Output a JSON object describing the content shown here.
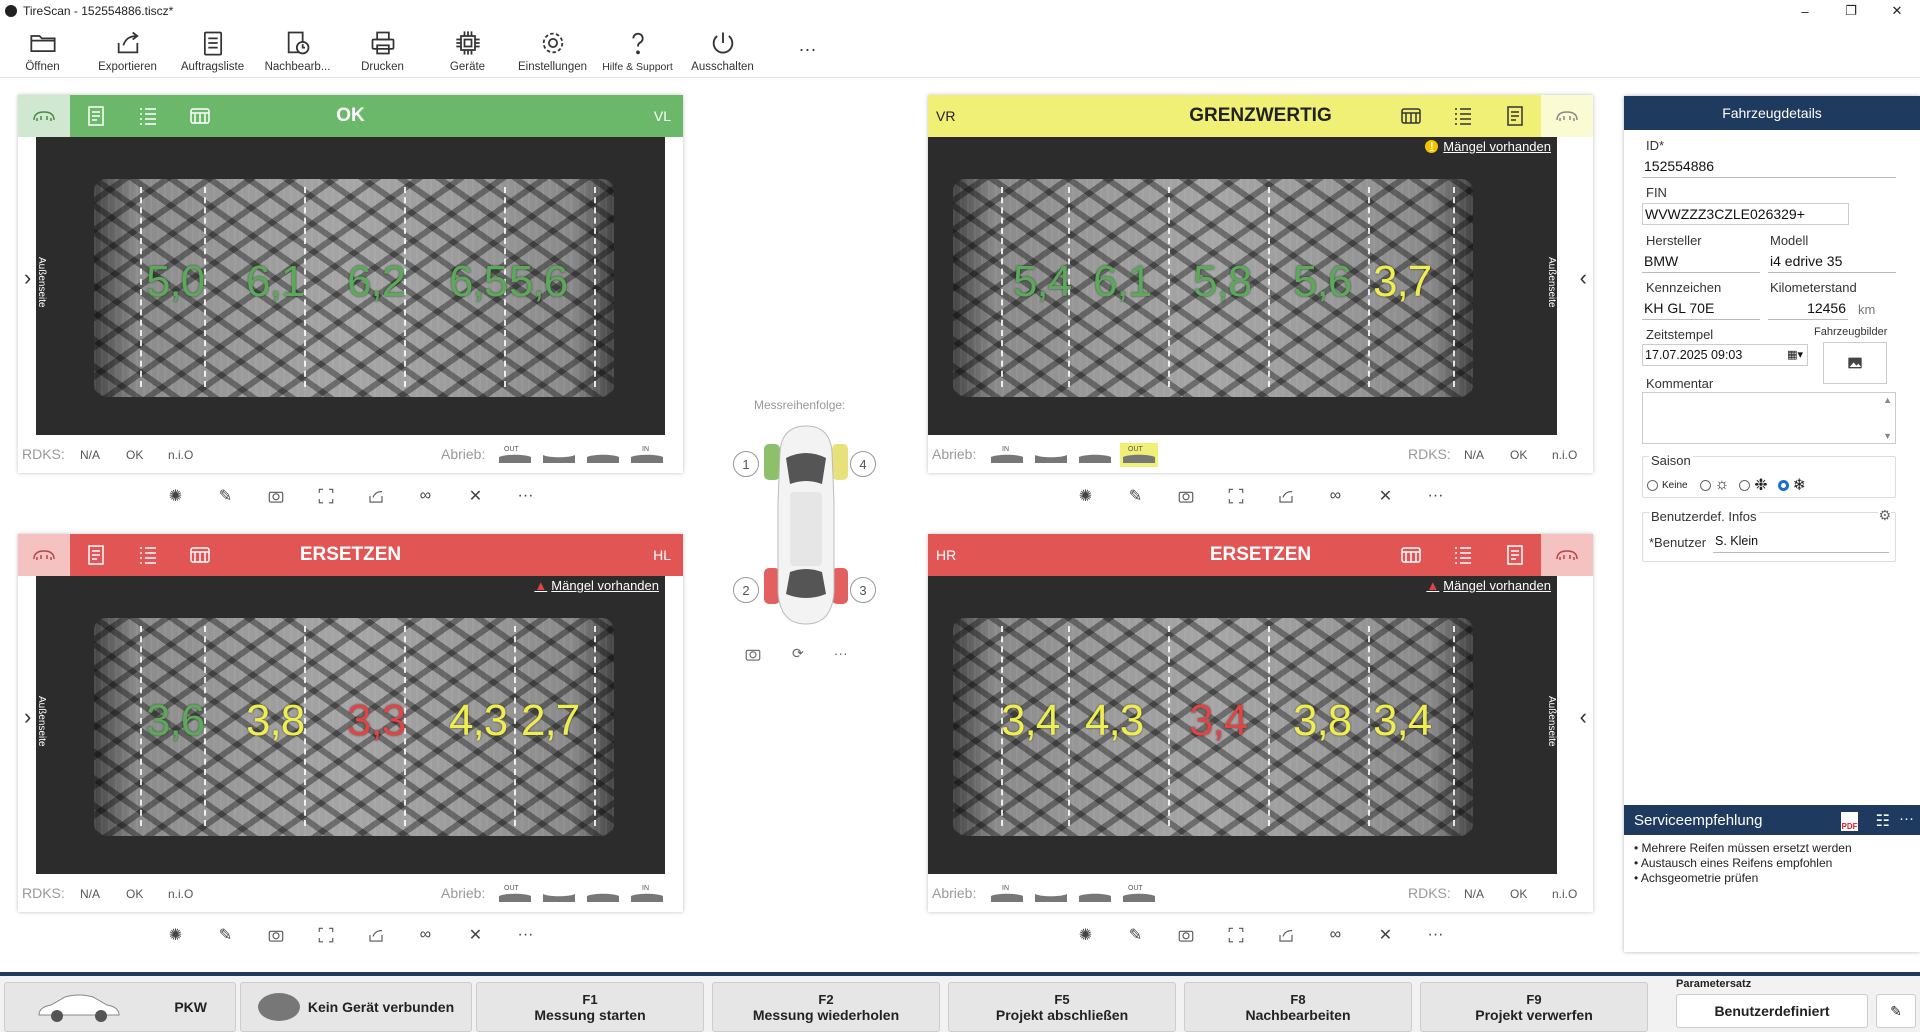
{
  "window": {
    "title": "TireScan - 152554886.tiscz*",
    "controls": [
      "–",
      "❐",
      "✕"
    ]
  },
  "toolbar": [
    {
      "label": "Öffnen",
      "icon": "folder-icon"
    },
    {
      "label": "Exportieren",
      "icon": "export-icon"
    },
    {
      "label": "Auftragsliste",
      "icon": "clipboard-icon"
    },
    {
      "label": "Nachbearb...",
      "icon": "edit-clock-icon"
    },
    {
      "label": "Drucken",
      "icon": "printer-icon"
    },
    {
      "label": "Geräte",
      "icon": "chip-icon"
    },
    {
      "label": "Einstellungen",
      "icon": "gear-icon"
    },
    {
      "label": "Hilfe & Support",
      "icon": "question-icon"
    },
    {
      "label": "Ausschalten",
      "icon": "power-icon"
    },
    {
      "label": "···",
      "icon": "more-icon"
    }
  ],
  "tires": {
    "vl": {
      "position": "VL",
      "status": "OK",
      "side": "Außenseite",
      "depths": [
        "5,0",
        "6,1",
        "6,2",
        "6,5",
        "5,6"
      ],
      "colors": [
        "green",
        "green",
        "green",
        "green",
        "green"
      ],
      "defect": ""
    },
    "vr": {
      "position": "VR",
      "status": "GRENZWERTIG",
      "side": "Außenseite",
      "depths": [
        "5,4",
        "6,1",
        "5,8",
        "5,6",
        "3,7"
      ],
      "colors": [
        "green",
        "green",
        "green",
        "green",
        "yellow"
      ],
      "defect": "Mängel vorhanden"
    },
    "hl": {
      "position": "HL",
      "status": "ERSETZEN",
      "side": "Außenseite",
      "depths": [
        "3,6",
        "3,8",
        "3,3",
        "4,3",
        "2,7"
      ],
      "colors": [
        "green",
        "yellow",
        "red",
        "yellow",
        "yellow"
      ],
      "defect": "Mängel vorhanden"
    },
    "hr": {
      "position": "HR",
      "status": "ERSETZEN",
      "side": "Außenseite",
      "depths": [
        "3,4",
        "4,3",
        "3,4",
        "3,8",
        "3,4"
      ],
      "colors": [
        "yellow",
        "yellow",
        "red",
        "yellow",
        "yellow"
      ],
      "defect": "Mängel vorhanden"
    }
  },
  "footer": {
    "rdks": "RDKS:",
    "na": "N/A",
    "ok": "OK",
    "nio": "n.i.O",
    "abrieb": "Abrieb:",
    "out": "OUT",
    "in": "IN"
  },
  "center": {
    "sequence_label": "Messreihenfolge:",
    "numbers": [
      "1",
      "4",
      "2",
      "3"
    ]
  },
  "details": {
    "title": "Fahrzeugdetails",
    "id_label": "ID*",
    "id": "152554886",
    "fin_label": "FIN",
    "fin": "WVWZZZ3CZLE026329+",
    "hersteller_label": "Hersteller",
    "hersteller": "BMW",
    "modell_label": "Modell",
    "modell": "i4 edrive 35",
    "kennzeichen_label": "Kennzeichen",
    "kennzeichen": "KH GL 70E",
    "km_label": "Kilometerstand",
    "km": "12456",
    "km_unit": "km",
    "zeit_label": "Zeitstempel",
    "zeit": "17.07.2025 09:03",
    "bilder_label": "Fahrzeugbilder",
    "kommentar_label": "Kommentar",
    "saison_label": "Saison",
    "saison_keine": "Keine",
    "saison_selected": "winter",
    "benutzer_infos_label": "Benutzerdef. Infos",
    "benutzer_label": "*Benutzer",
    "benutzer": "S. Klein"
  },
  "service": {
    "title": "Serviceempfehlung",
    "items": [
      "• Mehrere Reifen müssen ersetzt werden",
      "• Austausch eines Reifens empfohlen",
      "• Achsgeometrie prüfen"
    ]
  },
  "bottom": {
    "pkw": "PKW",
    "device": "Kein Gerät verbunden",
    "f1_key": "F1",
    "f1": "Messung starten",
    "f2_key": "F2",
    "f2": "Messung wiederholen",
    "f5_key": "F5",
    "f5": "Projekt abschließen",
    "f8_key": "F8",
    "f8": "Nachbearbeiten",
    "f9_key": "F9",
    "f9": "Projekt verwerfen",
    "param_label": "Parametersatz",
    "param": "Benutzerdefiniert"
  },
  "colors": {
    "ok": "#6bb86b",
    "warn": "#f0ef76",
    "bad": "#e25555",
    "navy": "#1f3a5f"
  }
}
